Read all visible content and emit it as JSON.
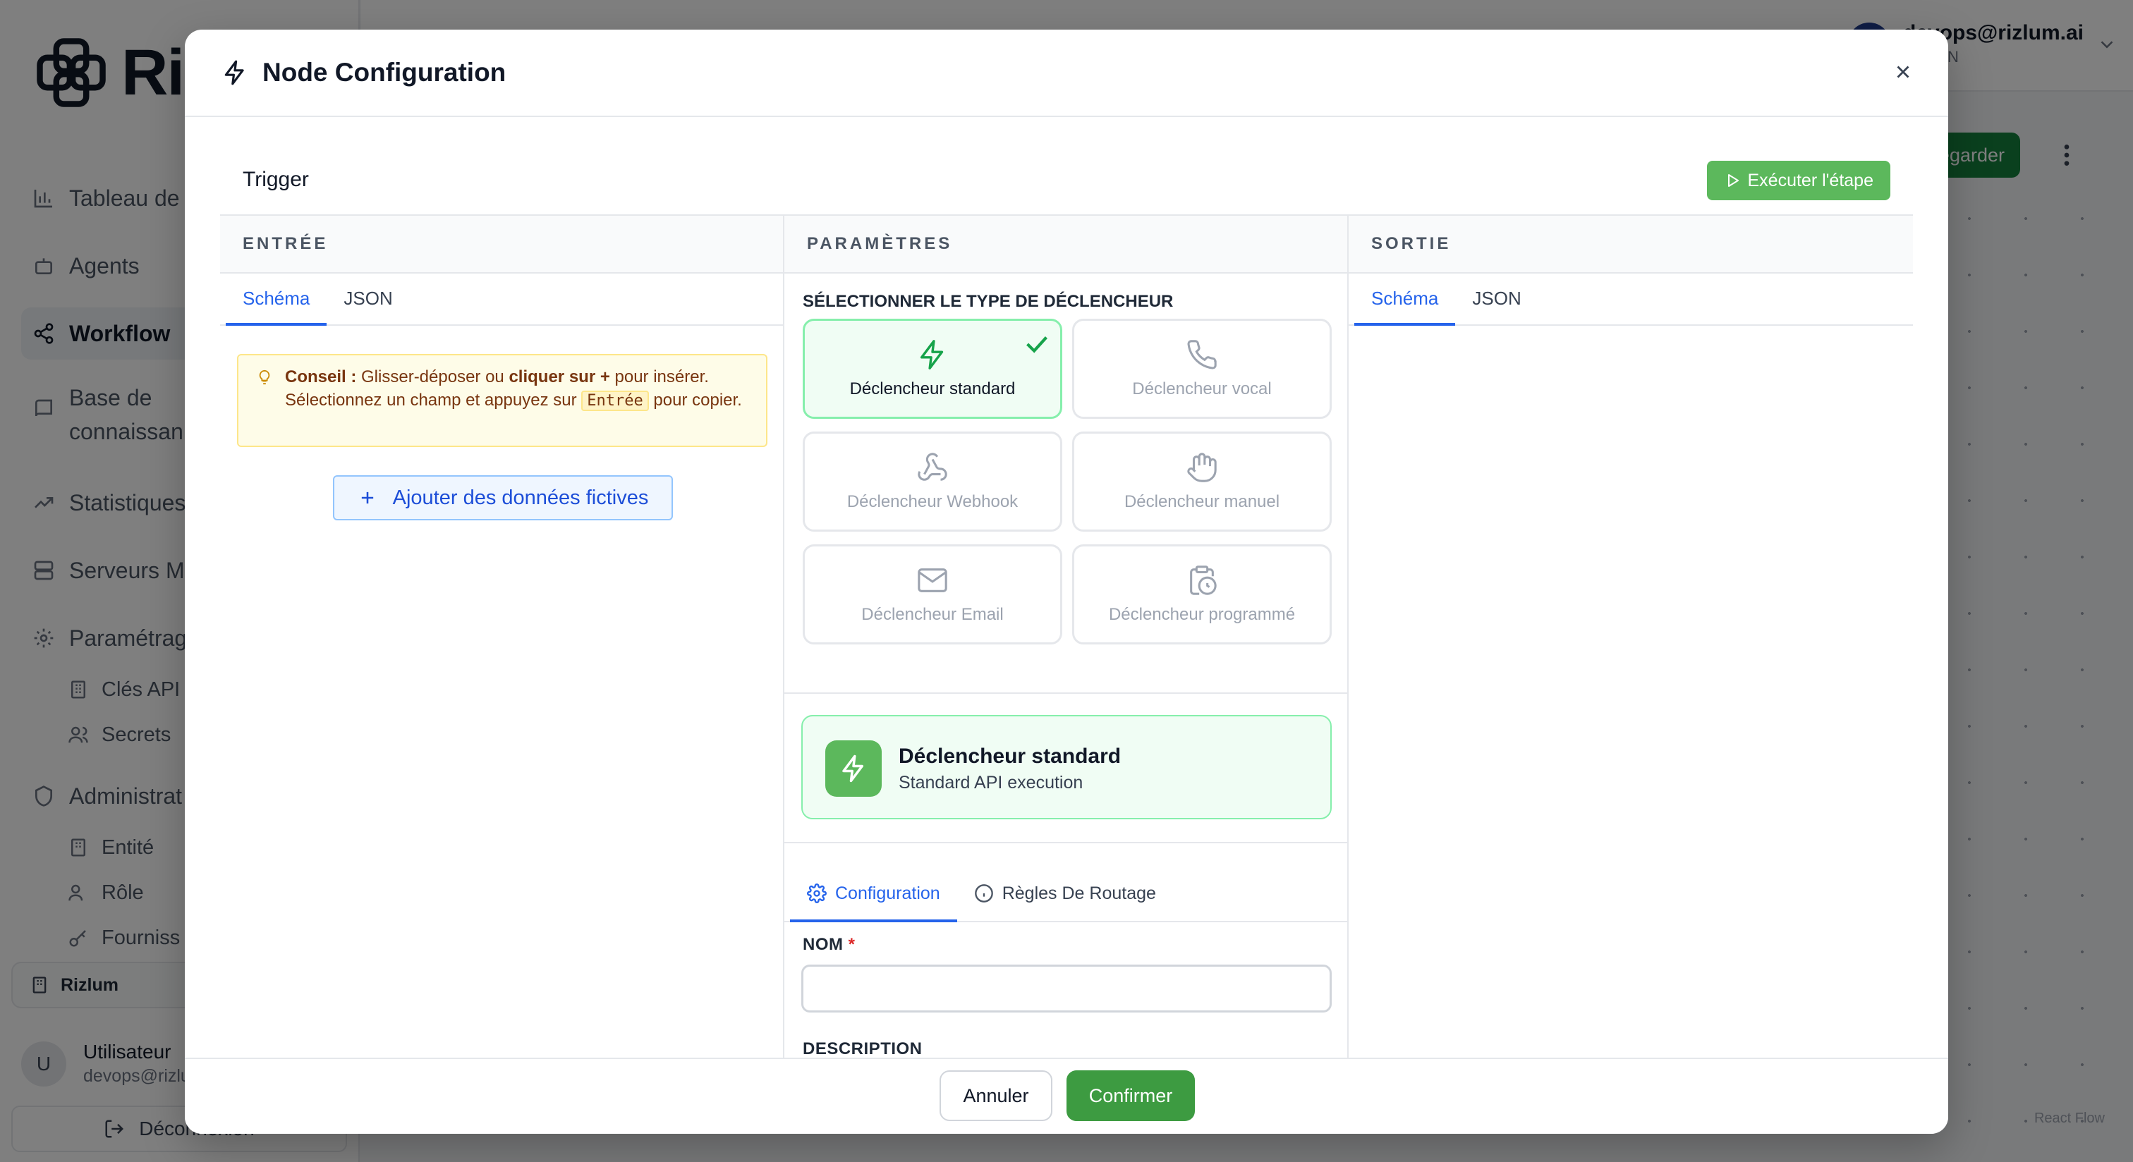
{
  "app": {
    "brand": "Ri",
    "nav": {
      "dashboard": "Tableau de",
      "agents": "Agents",
      "workflow": "Workflow",
      "knowledge": "Base de connaissan",
      "statistics": "Statistiques",
      "servers": "Serveurs M",
      "settings": "Paramétrag",
      "api_keys": "Clés API",
      "secrets": "Secrets",
      "admin": "Administrat",
      "entity": "Entité",
      "role": "Rôle",
      "providers": "Fourniss"
    },
    "tenant": "Rizlum",
    "user": {
      "initial": "U",
      "name": "Utilisateur",
      "email": "devops@rizlu",
      "logout": "Déconnexion"
    },
    "topbar": {
      "email": "devops@rizlum.ai",
      "role": "ADMIN"
    },
    "save_button": "Sauvegarder",
    "canvas_attribution": "React Flow"
  },
  "modal": {
    "title": "Node Configuration",
    "node_name": "Trigger",
    "execute_button": "Exécuter l'étape",
    "input_panel": {
      "header": "ENTRÉE",
      "tabs": [
        "Schéma",
        "JSON"
      ],
      "hint": {
        "lead": "Conseil :",
        "part1": "Glisser-déposer ou",
        "emph": "cliquer sur +",
        "part2": "pour insérer. Sélectionnez un champ et appuyez sur",
        "key": "Entrée",
        "part3": "pour copier."
      },
      "add_mock_button": "Ajouter des données fictives"
    },
    "params_panel": {
      "header": "PARAMÈTRES",
      "select_label": "SÉLECTIONNER LE TYPE DE DÉCLENCHEUR",
      "triggers": [
        {
          "label": "Déclencheur standard",
          "icon": "zap-icon",
          "selected": true
        },
        {
          "label": "Déclencheur vocal",
          "icon": "phone-icon",
          "selected": false
        },
        {
          "label": "Déclencheur Webhook",
          "icon": "webhook-icon",
          "selected": false
        },
        {
          "label": "Déclencheur manuel",
          "icon": "hand-icon",
          "selected": false
        },
        {
          "label": "Déclencheur Email",
          "icon": "mail-icon",
          "selected": false
        },
        {
          "label": "Déclencheur programmé",
          "icon": "clipboard-clock-icon",
          "selected": false
        }
      ],
      "summary": {
        "title": "Déclencheur standard",
        "subtitle": "Standard API execution"
      },
      "config_tabs": [
        "Configuration",
        "Règles De Routage"
      ],
      "name_label": "NOM",
      "name_required_mark": "*",
      "name_value": "",
      "description_label": "DESCRIPTION"
    },
    "output_panel": {
      "header": "SORTIE",
      "tabs": [
        "Schéma",
        "JSON"
      ]
    },
    "footer": {
      "cancel": "Annuler",
      "confirm": "Confirmer"
    }
  },
  "colors": {
    "accent_blue": "#2563eb",
    "success_green": "#5cb85c",
    "confirm_green": "#3d9b41",
    "hint_bg": "#fefce8"
  }
}
